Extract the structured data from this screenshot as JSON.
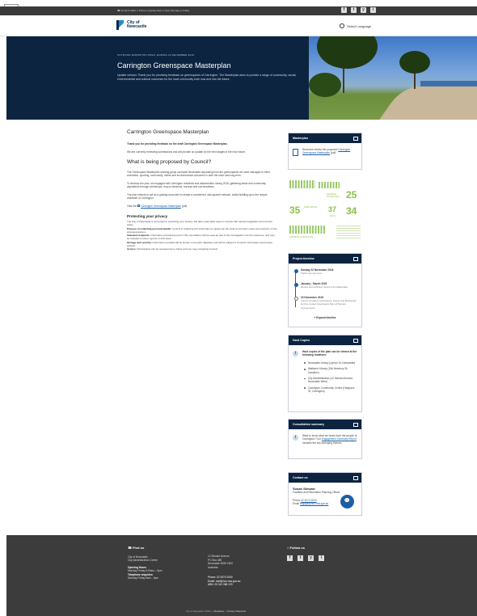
{
  "skip": {
    "label": "Translate"
  },
  "topbar": {
    "contact": "☎ 02 4974 2000   ⏲ Phone enquiries 8am to 5pm Monday to Friday",
    "social": [
      "f",
      "t",
      "y",
      "i"
    ]
  },
  "header": {
    "logo_text": "City of Newcastle",
    "language_label": "Select Language"
  },
  "hero": {
    "date": "OUTDOOR EXHIBITION OPEN, ENDING 20 DECEMBER 2019",
    "title": "Carrington Greenspace Masterplan",
    "lead": "Update version: Thank you for providing feedback on greenspaces of Carrington. The Masterplan aims to provide a range of community, social, environmental and cultural outcomes for the local community both now and into the future."
  },
  "main": {
    "title": "Carrington Greenspace Masterplan",
    "thanks": "Thank you for providing feedback on the draft Carrington Greenspace Masterplan.",
    "p1": "We are currently reviewing submissions and will provide an update on the next stages in the near future.",
    "h_proposed": "What is being proposed by Council?",
    "p2": "The Greenspace Masterplan working group surveyed Newcastle requesting from the greenspaces we need managed to meet recreation, sporting, community, needs and environmental outcomes in both the short and long term.",
    "p3": "To develop the plan, we engaged with Carrington residents and stakeholders during 2018, gathering ideas and community aspirations through workshops, drop-in sessions, surveys and conversations.",
    "p4": "The plan intends to act as a guiding document to shape a considered, well-spaced network, whilst building upon the unique character of Carrington.",
    "view_prefix": "View the",
    "view_link": "Carrington Greenspace Masterplan",
    "view_suffix": "(pdf)",
    "h_privacy": "Protecting your privacy",
    "privacy": [
      {
        "lead": "",
        "text": "The City of Newcastle is committed to protecting your privacy. We take reasonable steps to comply with relevant legislation and Council policy."
      },
      {
        "lead": "Purpose of collecting personal details:",
        "text": "Council is collecting this information to determine the local community's views and opinions on the proposed actions."
      },
      {
        "lead": "Intended recipients:",
        "text": "Information provided as part of this consultation will be used as part of the investigation into the outcomes, and may be included in future reports on this issue."
      },
      {
        "lead": "Storage and security:",
        "text": "Information provided will be stored in Council's database and will be subject to Council's information and privacy policies."
      },
      {
        "lead": "Access:",
        "text": "Submissions can be accessed as to future and you may contacting Council."
      }
    ]
  },
  "sidebar": {
    "masterplan": {
      "title": "Masterplan",
      "text": "Read and review the proposed",
      "link": "Carrington Greenspace Masterplan",
      "suffix": "(pdf)"
    },
    "infographic": {
      "n1": "25",
      "n2": "35",
      "n3": "37",
      "n4": "34",
      "l1": "AVERAGE HOUSEHOLD",
      "l2": "OPEN SPACE",
      "l3": "DAYS",
      "l4": "GROWING POPULATION"
    },
    "timeline": {
      "title": "Project timeline",
      "items": [
        {
          "t": "Sunday 22 November 2018",
          "s": "Public open-air event"
        },
        {
          "t": "January - March 2020",
          "s": "Review and exhibition period of the Masterplan"
        },
        {
          "t": "20 November 2019",
          "s": "Council considers submissions, adopts final Masterplan and the revised Greenspace Plan of Planned Improvements"
        }
      ],
      "expand": "+  Expand timeline"
    },
    "hard": {
      "title": "Hard Copies",
      "lead": "Hard copies of the plan can be viewed at the following locations:",
      "items": [
        "Newcastle Library (Lyman St, Newcastle)",
        "Wallsend Library (18A Newbury St, Hamilton)",
        "City Administration (12 Stewart Avenue, Newcastle West)",
        "Carrington Community Centre (Hargrave St, Carrington)"
      ]
    },
    "consult": {
      "title": "Consultation summary",
      "prefix": "Want to know what we heard from the people of Carrington? Our",
      "link": "Engagement Summary Report",
      "suffix": "includes the key emerging themes."
    },
    "contact": {
      "title": "Contact us",
      "name": "Susan Stewart",
      "role": "Facilities and Recreation Planning Officer",
      "phone_label": "Phone",
      "phone": "02 4974 2000",
      "email_label": "Email",
      "email": "engage@ncc.nsw.gov.au"
    }
  },
  "chat": {
    "glyph": "💬"
  },
  "footer": {
    "find": {
      "title": "Find us",
      "lines": [
        "City of Newcastle",
        "City Administration Centre",
        "",
        "Opening Hours",
        "Monday-Friday 8:30am – 5pm",
        "Telephone enquiries",
        "Monday-Friday 8am – 5pm"
      ]
    },
    "address": {
      "lines": [
        "12 Stewart Avenue",
        "PO Box 489",
        "Newcastle NSW 2300",
        "Australia",
        "",
        "",
        "Phone: 02 4974 2000",
        "Email: mail@ncc.nsw.gov.au",
        "ABN: 25 242 068 129"
      ]
    },
    "follow": {
      "title": "Follow us",
      "social": [
        "f",
        "t",
        "y",
        "i"
      ]
    },
    "legal": {
      "copy": "City of Newcastle ©2020",
      "disclaimer": "Disclaimer",
      "privacy": "Privacy Statement"
    }
  }
}
